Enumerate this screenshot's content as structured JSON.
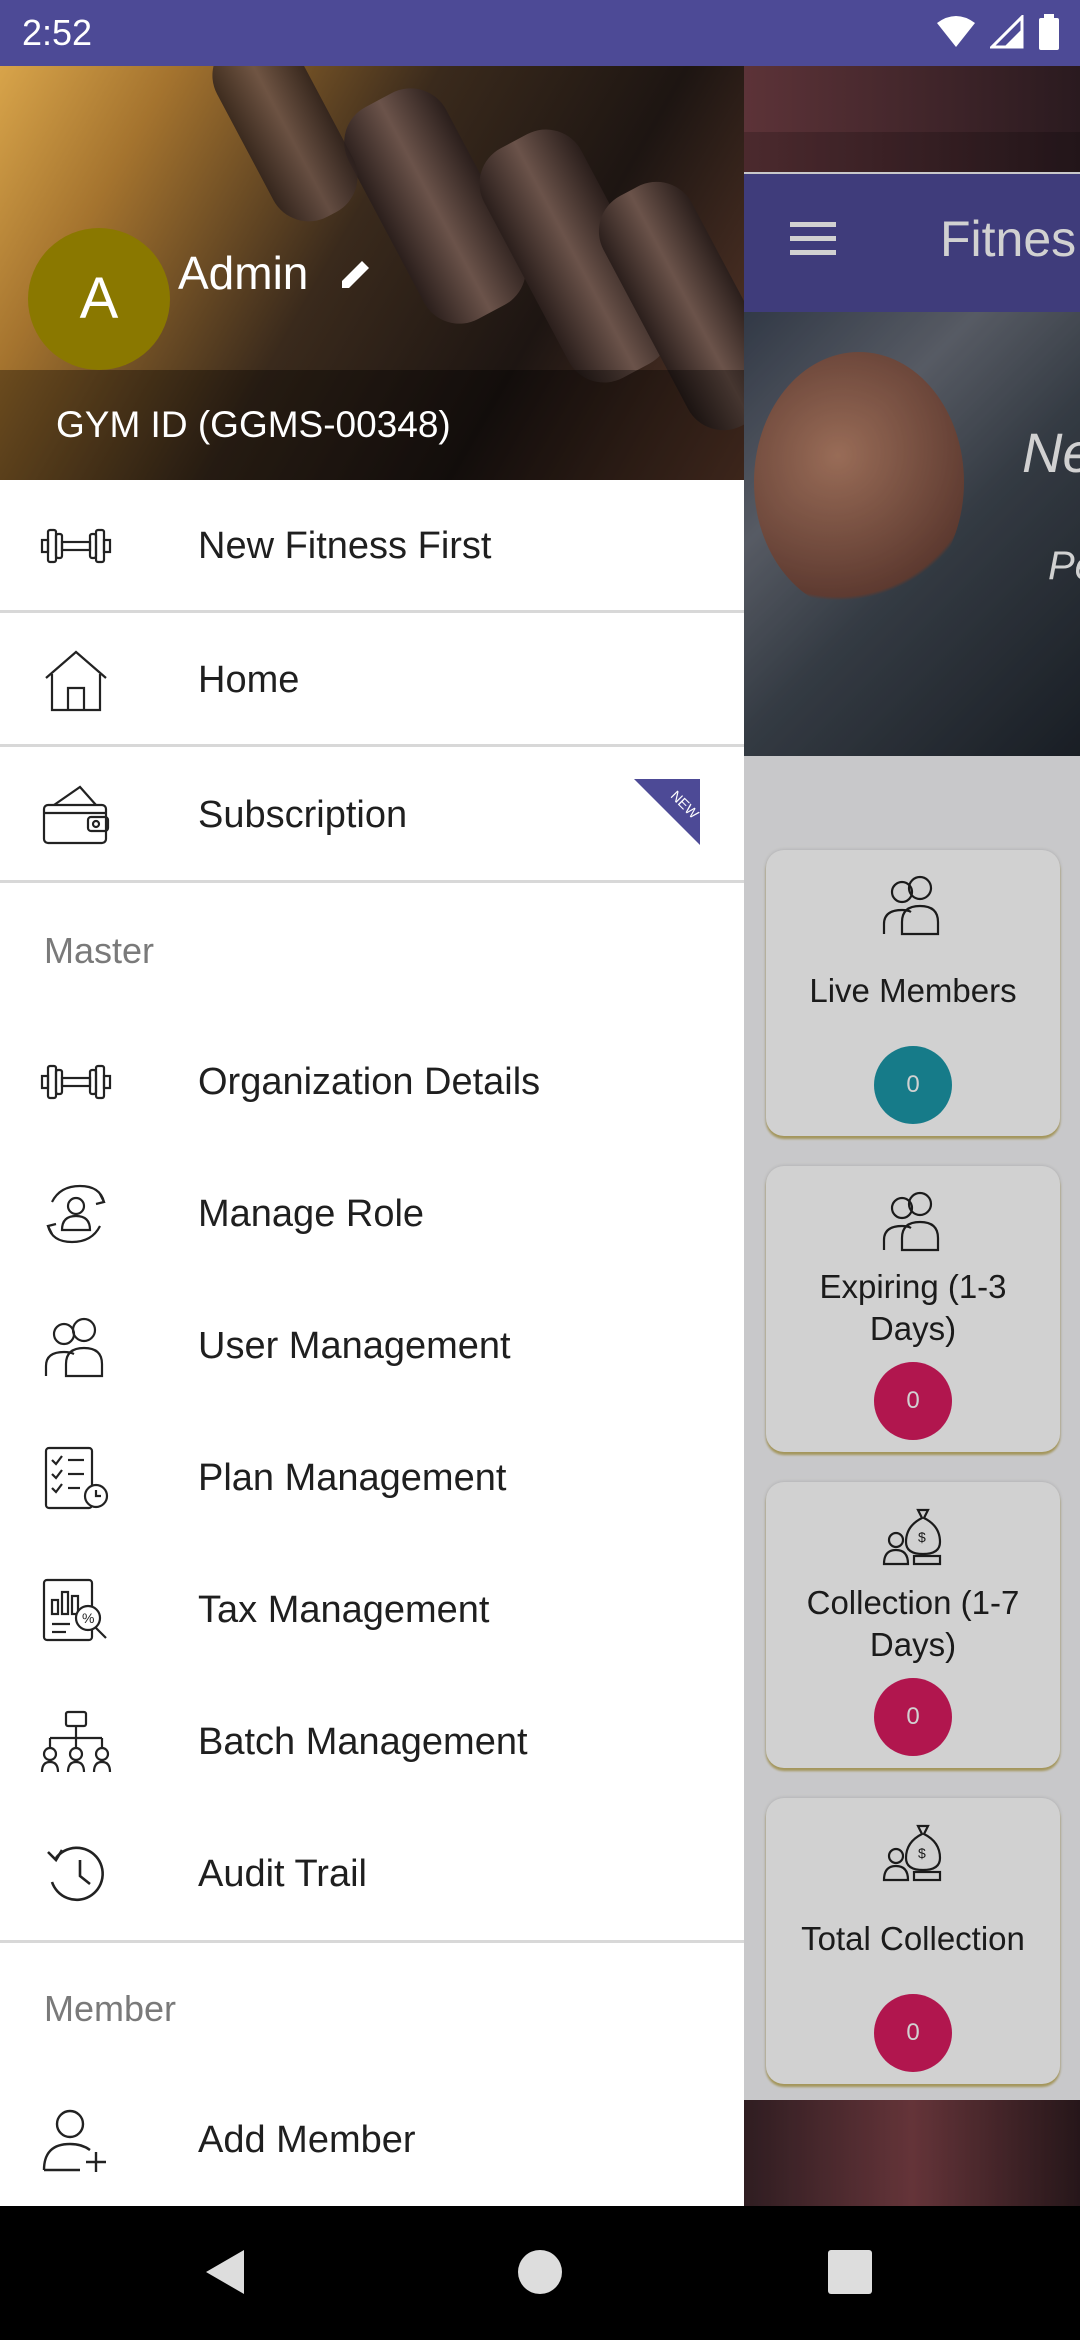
{
  "status_bar": {
    "time": "2:52"
  },
  "drawer": {
    "avatar_letter": "A",
    "user_name": "Admin",
    "gym_id": "GYM ID (GGMS-00348)",
    "top_items": [
      {
        "label": "New Fitness First",
        "icon": "dumbbell-icon"
      },
      {
        "label": "Home",
        "icon": "home-icon"
      },
      {
        "label": "Subscription",
        "icon": "wallet-icon",
        "badge": "NEW"
      }
    ],
    "master_section": "Master",
    "master_items": [
      {
        "label": "Organization Details",
        "icon": "dumbbell-icon"
      },
      {
        "label": "Manage Role",
        "icon": "role-icon"
      },
      {
        "label": "User Management",
        "icon": "users-icon"
      },
      {
        "label": "Plan Management",
        "icon": "checklist-icon"
      },
      {
        "label": "Tax Management",
        "icon": "tax-report-icon"
      },
      {
        "label": "Batch Management",
        "icon": "org-chart-icon"
      },
      {
        "label": "Audit Trail",
        "icon": "history-icon"
      }
    ],
    "member_section": "Member",
    "member_items": [
      {
        "label": "Add Member",
        "icon": "add-user-icon"
      }
    ]
  },
  "app": {
    "toolbar_title": "Fitnes",
    "hero_line1": "Ne",
    "hero_line2": "Pe",
    "cards": [
      {
        "label": "Live Members",
        "value": "0",
        "color": "#1b97a8",
        "icon": "users-icon"
      },
      {
        "label": "Expiring (1-3 Days)",
        "value": "0",
        "color": "#d81b60",
        "icon": "users-icon"
      },
      {
        "label": "Collection (1-7 Days)",
        "value": "0",
        "color": "#d81b60",
        "icon": "money-bag-icon"
      },
      {
        "label": "Total Collection",
        "value": "0",
        "color": "#d81b60",
        "icon": "money-bag-icon"
      }
    ]
  },
  "colors": {
    "primary": "#4d4a96",
    "avatar": "#8a7800",
    "badge_pink": "#d81b60",
    "badge_teal": "#1b97a8"
  }
}
